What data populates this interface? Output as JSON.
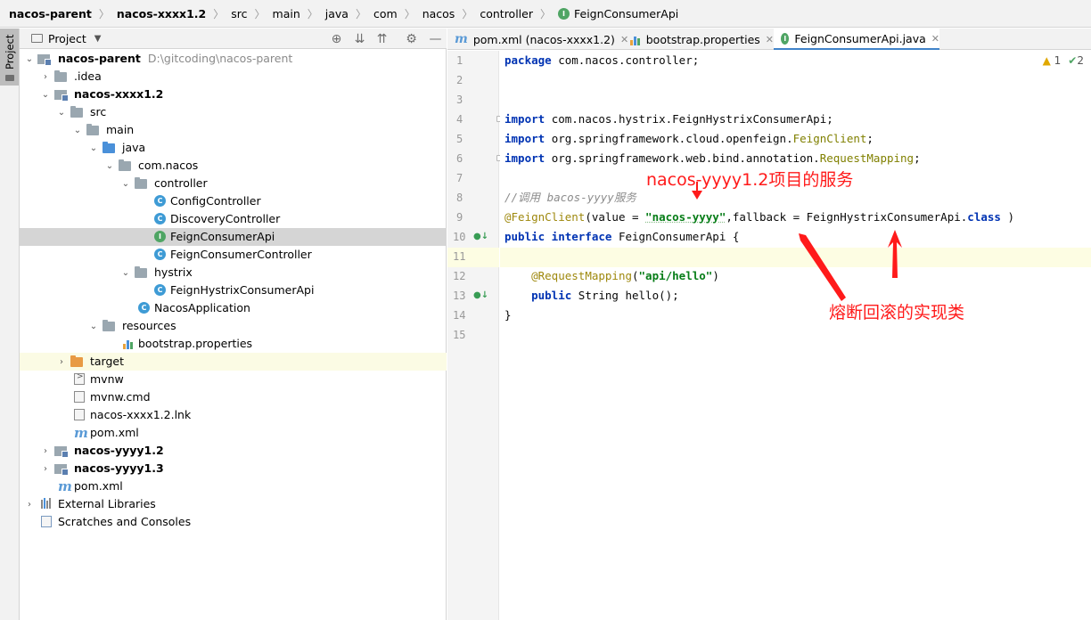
{
  "breadcrumb": {
    "items": [
      "nacos-parent",
      "nacos-xxxx1.2",
      "src",
      "main",
      "java",
      "com",
      "nacos",
      "controller",
      "FeignConsumerApi"
    ]
  },
  "tool_stripe": {
    "project_tab": "Project"
  },
  "project_panel": {
    "title": "Project",
    "tree": [
      {
        "label": "nacos-parent",
        "hint": "D:\\gitcoding\\nacos-parent",
        "bold": true
      },
      {
        "label": ".idea"
      },
      {
        "label": "nacos-xxxx1.2",
        "bold": true
      },
      {
        "label": "src"
      },
      {
        "label": "main"
      },
      {
        "label": "java"
      },
      {
        "label": "com.nacos"
      },
      {
        "label": "controller"
      },
      {
        "label": "ConfigController"
      },
      {
        "label": "DiscoveryController"
      },
      {
        "label": "FeignConsumerApi"
      },
      {
        "label": "FeignConsumerController"
      },
      {
        "label": "hystrix"
      },
      {
        "label": "FeignHystrixConsumerApi"
      },
      {
        "label": "NacosApplication"
      },
      {
        "label": "resources"
      },
      {
        "label": "bootstrap.properties"
      },
      {
        "label": "target"
      },
      {
        "label": "mvnw"
      },
      {
        "label": "mvnw.cmd"
      },
      {
        "label": "nacos-xxxx1.2.lnk"
      },
      {
        "label": "pom.xml"
      },
      {
        "label": "nacos-yyyy1.2",
        "bold": true
      },
      {
        "label": "nacos-yyyy1.3",
        "bold": true
      },
      {
        "label": "pom.xml"
      },
      {
        "label": "External Libraries"
      },
      {
        "label": "Scratches and Consoles"
      }
    ]
  },
  "editor": {
    "tabs": [
      {
        "label": "pom.xml (nacos-xxxx1.2)"
      },
      {
        "label": "bootstrap.properties"
      },
      {
        "label": "FeignConsumerApi.java",
        "active": true
      }
    ],
    "inspections": {
      "warnings": "1",
      "ok": "2"
    },
    "line_numbers": [
      "1",
      "2",
      "3",
      "4",
      "5",
      "6",
      "7",
      "8",
      "9",
      "10",
      "11",
      "12",
      "13",
      "14",
      "15"
    ],
    "code_lines": [
      "package com.nacos.controller;",
      "",
      "",
      "import com.nacos.hystrix.FeignHystrixConsumerApi;",
      "import org.springframework.cloud.openfeign.FeignClient;",
      "import org.springframework.web.bind.annotation.RequestMapping;",
      "",
      "//调用 bacos-yyyy服务",
      "@FeignClient(value = \"nacos-yyyy\",fallback = FeignHystrixConsumerApi.class )",
      "public interface FeignConsumerApi {",
      "",
      "    @RequestMapping(\"api/hello\")",
      "    public String hello();",
      "}",
      ""
    ]
  },
  "annotations": {
    "service_note": "nacos-yyyy1.2项目的服务",
    "fallback_note": "熔断回滚的实现类",
    "color": "#ff1a1a"
  },
  "colors": {
    "keyword": "#0033b3",
    "string": "#067d17",
    "annotation": "#9e880d",
    "comment": "#8c8c8c",
    "selection": "#d5d5d5",
    "current_line": "#fdfde3",
    "tab_underline": "#4083c9"
  }
}
